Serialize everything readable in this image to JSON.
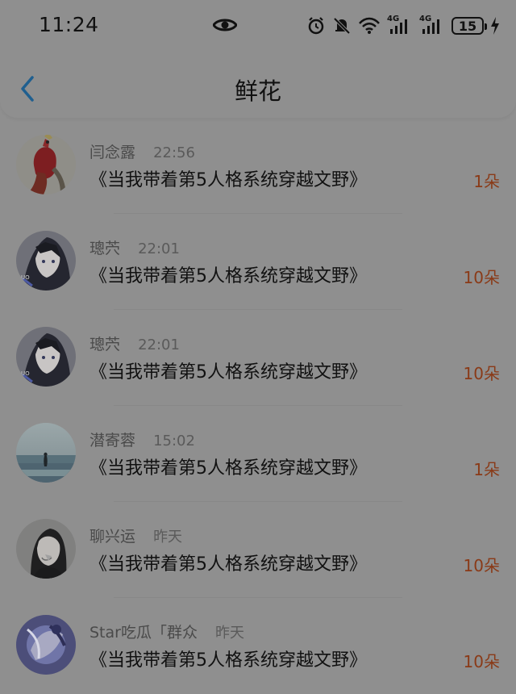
{
  "status_bar": {
    "time": "11:24",
    "battery": "15",
    "icons": [
      "eye-icon",
      "alarm-icon",
      "mute-icon",
      "wifi-icon",
      "signal-4g-icon",
      "signal-4g-icon",
      "battery-icon",
      "charging-icon"
    ],
    "network_labels": [
      "4G",
      "4G"
    ]
  },
  "header": {
    "title": "鲜花",
    "back_icon": "chevron-left-icon"
  },
  "colors": {
    "accent": "#8a3a17",
    "back_icon": "#1f5f8f",
    "overlay_background": "#8f8f8f"
  },
  "list": [
    {
      "name": "闫念露",
      "time": "22:56",
      "book": "《当我带着第5人格系统穿越文野》",
      "count": "1朵",
      "avatar_icon": "avatar-flamingo"
    },
    {
      "name": "璁茓",
      "time": "22:01",
      "book": "《当我带着第5人格系统穿越文野》",
      "count": "10朵",
      "avatar_icon": "avatar-anime"
    },
    {
      "name": "璁茓",
      "time": "22:01",
      "book": "《当我带着第5人格系统穿越文野》",
      "count": "10朵",
      "avatar_icon": "avatar-anime"
    },
    {
      "name": "潜寄蓉",
      "time": "15:02",
      "book": "《当我带着第5人格系统穿越文野》",
      "count": "1朵",
      "avatar_icon": "avatar-sea"
    },
    {
      "name": "聊兴运",
      "time": "昨天",
      "book": "《当我带着第5人格系统穿越文野》",
      "count": "10朵",
      "avatar_icon": "avatar-portrait"
    },
    {
      "name": "Star吃瓜「群众",
      "time": "昨天",
      "book": "《当我带着第5人格系统穿越文野》",
      "count": "10朵",
      "avatar_icon": "avatar-violet"
    }
  ]
}
